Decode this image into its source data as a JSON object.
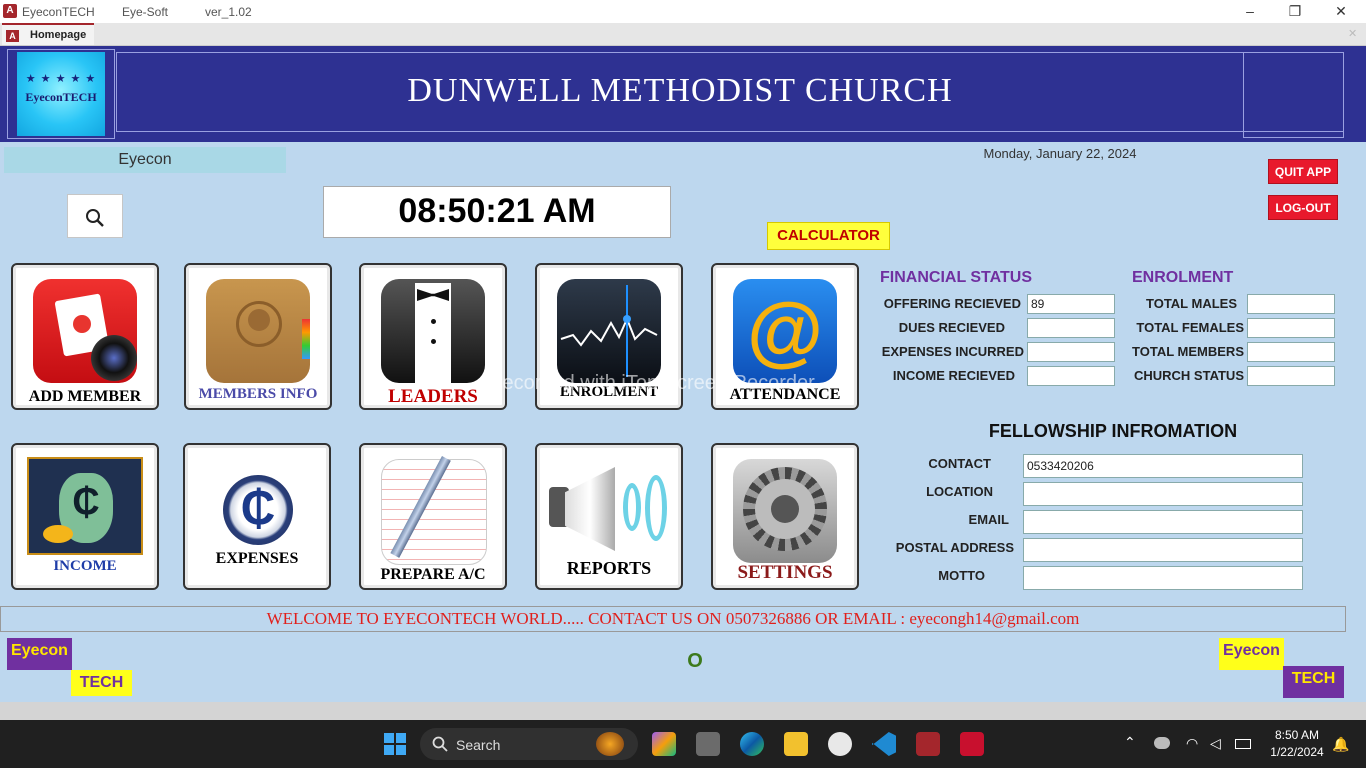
{
  "titlebar": {
    "app_icon_letter": "A",
    "app_name": "EyeconTECH",
    "company": "Eye-Soft",
    "version": "ver_1.02",
    "minimize_glyph": "–",
    "maximize_glyph": "❐",
    "close_glyph": "✕"
  },
  "tab": {
    "icon_letter": "A",
    "label": "Homepage",
    "close_glyph": "✕"
  },
  "header": {
    "logo_stars": "★ ★ ★ ★ ★",
    "logo_text": "EyeconTECH",
    "title": "DUNWELL METHODIST CHURCH",
    "bg_color": "#2e3192"
  },
  "user_box": "Eyecon",
  "date": "Monday, January 22, 2024",
  "buttons": {
    "quit": "QUIT APP",
    "logout": "LOG-OUT",
    "calculator": "CALCULATOR"
  },
  "clock": "08:50:21 AM",
  "tiles": [
    {
      "label": "ADD MEMBER",
      "icon": "camera-photo-icon",
      "color": "#000000"
    },
    {
      "label": "MEMBERS INFO",
      "icon": "contacts-book-icon",
      "color": "#4a4aa8"
    },
    {
      "label": "LEADERS",
      "icon": "tuxedo-icon",
      "color": "#c00000"
    },
    {
      "label": "ENROLMENT",
      "icon": "stock-chart-icon",
      "color": "#000000"
    },
    {
      "label": "ATTENDANCE",
      "icon": "at-mail-icon",
      "color": "#000000"
    },
    {
      "label": "INCOME",
      "icon": "money-bag-icon",
      "color": "#1f3da8"
    },
    {
      "label": "EXPENSES",
      "icon": "cedi-coin-icon",
      "color": "#000000"
    },
    {
      "label": "PREPARE A/C",
      "icon": "notepad-pen-icon",
      "color": "#000000"
    },
    {
      "label": "REPORTS",
      "icon": "speaker-icon",
      "color": "#000000"
    },
    {
      "label": "SETTINGS",
      "icon": "gear-icon",
      "color": "#8b1a1a"
    }
  ],
  "financial": {
    "title": "FINANCIAL STATUS",
    "fields": [
      {
        "label": "OFFERING RECIEVED",
        "value": "89"
      },
      {
        "label": "DUES RECIEVED",
        "value": ""
      },
      {
        "label": "EXPENSES INCURRED",
        "value": ""
      },
      {
        "label": "INCOME RECIEVED",
        "value": ""
      }
    ]
  },
  "enrolment": {
    "title": "ENROLMENT",
    "fields": [
      {
        "label": "TOTAL MALES",
        "value": ""
      },
      {
        "label": "TOTAL FEMALES",
        "value": ""
      },
      {
        "label": "TOTAL MEMBERS",
        "value": ""
      },
      {
        "label": "CHURCH STATUS",
        "value": ""
      }
    ]
  },
  "fellowship": {
    "title": "FELLOWSHIP INFROMATION",
    "fields": [
      {
        "label": "CONTACT",
        "value": "0533420206"
      },
      {
        "label": "LOCATION",
        "value": ""
      },
      {
        "label": "EMAIL",
        "value": ""
      },
      {
        "label": "POSTAL ADDRESS",
        "value": ""
      },
      {
        "label": "MOTTO",
        "value": ""
      }
    ]
  },
  "marquee": "WELCOME TO EYECONTECH WORLD..... CONTACT US ON 0507326886 OR EMAIL : eyecongh14@gmail.com",
  "footer": {
    "left_top": "Eyecon",
    "left_bottom": "TECH",
    "right_top": "Eyecon",
    "right_bottom": "TECH",
    "center": "O"
  },
  "watermark": "Recorded with iTop Screen Recorder",
  "taskbar": {
    "search_label": "Search",
    "time": "8:50 AM",
    "date": "1/22/2024"
  }
}
